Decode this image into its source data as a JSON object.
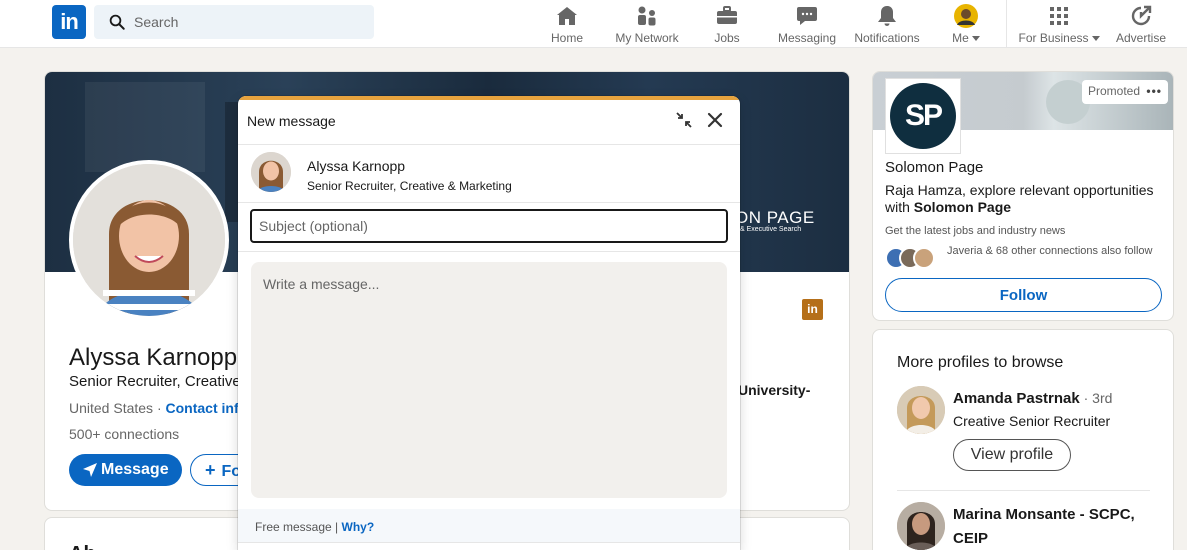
{
  "nav": {
    "logo_text": "in",
    "search_placeholder": "Search",
    "items": [
      {
        "label": "Home",
        "icon": "home-icon"
      },
      {
        "label": "My Network",
        "icon": "network-icon"
      },
      {
        "label": "Jobs",
        "icon": "briefcase-icon"
      },
      {
        "label": "Messaging",
        "icon": "chat-icon"
      },
      {
        "label": "Notifications",
        "icon": "bell-icon"
      },
      {
        "label": "Me",
        "icon": "avatar-icon"
      },
      {
        "label": "For Business",
        "icon": "grid-icon"
      },
      {
        "label": "Advertise",
        "icon": "advertise-icon"
      }
    ],
    "accent": "#0a66c2"
  },
  "profile": {
    "banner_company": "ON PAGE",
    "banner_tagline": "& Executive Search",
    "name": "Alyssa Karnopp",
    "headline": "Senior Recruiter, Creative",
    "location": "United States ·",
    "contact_info": "Contact info",
    "connections": "500+ connections",
    "message_button": "Message",
    "follow_button": "Fo",
    "education_logo": "in",
    "education_text": "University-",
    "next_section_title": "Ab"
  },
  "modal": {
    "title": "New message",
    "recipient_name": "Alyssa Karnopp",
    "recipient_headline": "Senior Recruiter, Creative & Marketing",
    "subject_placeholder": "Subject (optional)",
    "subject_value": "",
    "body_placeholder": "Write a message...",
    "footer_text": "Free message |",
    "footer_link": "Why?",
    "accent": "#e7a33e"
  },
  "promoted": {
    "badge": "Promoted",
    "logo_text": "SP",
    "company": "Solomon Page",
    "pitch_prefix": "Raja Hamza, explore relevant opportunities with ",
    "pitch_company": "Solomon Page",
    "info": "Get the latest jobs and industry news",
    "connections": "Javeria & 68 other connections also follow",
    "follow_button": "Follow"
  },
  "browse": {
    "title": "More profiles to browse",
    "profiles": [
      {
        "name": "Amanda Pastrnak",
        "degree": " · 3rd",
        "headline": "Creative Senior Recruiter",
        "button": "View profile"
      },
      {
        "name": "Marina Monsante - SCPC,",
        "name_line2": "CEIP"
      }
    ]
  }
}
